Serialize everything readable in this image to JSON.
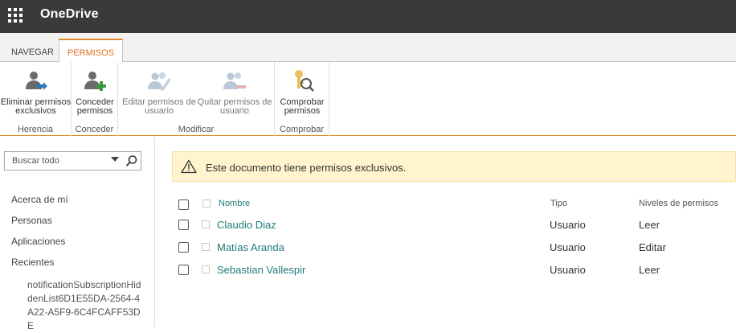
{
  "suite": {
    "brand": "OneDrive",
    "app_launcher_icon": "waffle-icon"
  },
  "ribbon": {
    "tabs": [
      {
        "label": "NAVEGAR"
      },
      {
        "label": "PERMISOS"
      }
    ],
    "active_tab": "PERMISOS",
    "accent_color": "#e08a2a",
    "groups": [
      {
        "label": "Herencia",
        "buttons": [
          {
            "label": "Eliminar permisos\nexclusivos",
            "icon": "remove-unique-permissions-icon",
            "enabled": true
          }
        ]
      },
      {
        "label": "Conceder",
        "buttons": [
          {
            "label": "Conceder\npermisos",
            "icon": "grant-permissions-icon",
            "enabled": true
          }
        ]
      },
      {
        "label": "Modificar",
        "buttons": [
          {
            "label": "Editar permisos de\nusuario",
            "icon": "edit-user-permissions-icon",
            "enabled": false
          },
          {
            "label": "Quitar permisos de\nusuario",
            "icon": "remove-user-permissions-icon",
            "enabled": false
          }
        ]
      },
      {
        "label": "Comprobar",
        "buttons": [
          {
            "label": "Comprobar\npermisos",
            "icon": "check-permissions-icon",
            "enabled": true
          }
        ]
      }
    ]
  },
  "leftnav": {
    "search_placeholder": "Buscar todo",
    "links": [
      "Acerca de mí",
      "Personas",
      "Aplicaciones",
      "Recientes"
    ],
    "recent_item": "notificationSubscriptionHiddenList6D1E55DA-2564-4A22-A5F9-6C4FCAFF53DE"
  },
  "banner": {
    "message": "Este documento tiene permisos exclusivos.",
    "icon": "warning-icon",
    "background": "#fff4ce"
  },
  "table": {
    "headers": {
      "name": "Nombre",
      "type": "Tipo",
      "level": "Niveles de permisos"
    },
    "rows": [
      {
        "name": "Claudio Diaz",
        "type": "Usuario",
        "level": "Leer"
      },
      {
        "name": "Matías Aranda",
        "type": "Usuario",
        "level": "Editar"
      },
      {
        "name": "Sebastian Vallespir",
        "type": "Usuario",
        "level": "Leer"
      }
    ],
    "link_color": "#207a7a"
  }
}
